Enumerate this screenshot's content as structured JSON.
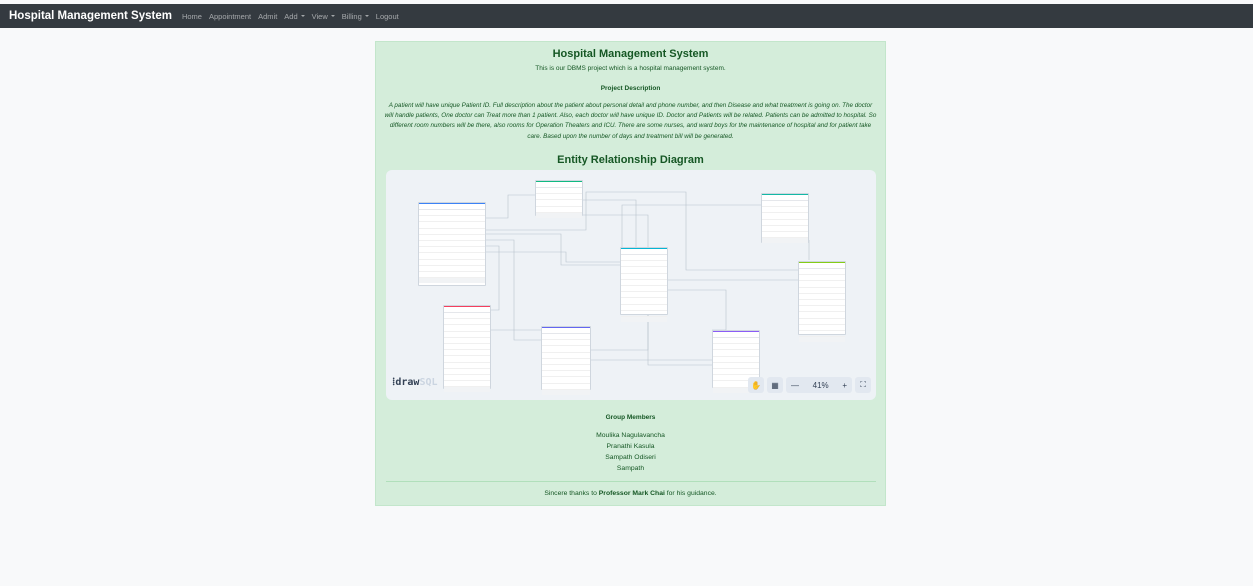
{
  "navbar": {
    "brand": "Hospital Management System",
    "items": [
      {
        "label": "Home",
        "dropdown": false
      },
      {
        "label": "Appointment",
        "dropdown": false
      },
      {
        "label": "Admit",
        "dropdown": false
      },
      {
        "label": "Add",
        "dropdown": true
      },
      {
        "label": "View",
        "dropdown": true
      },
      {
        "label": "Billing",
        "dropdown": true
      },
      {
        "label": "Logout",
        "dropdown": false
      }
    ]
  },
  "card": {
    "title": "Hospital Management System",
    "subtitle": "This is our DBMS project which is a hospital management system.",
    "description_heading": "Project Description",
    "description": "A patient will have unique Patient ID. Full description about the patient about personal detail and phone number, and then Disease and what treatment is going on. The doctor will handle patients, One doctor can Treat more than 1 patient. Also, each doctor will have unique ID. Doctor and Patients will be related. Patients can be admitted to hospital. So different room numbers will be there, also rooms for Operation Theaters and ICU. There are some nurses, and ward boys for the maintenance of hospital and for patient take care. Based upon the number of days and treatment bill will be generated.",
    "erd_heading": "Entity Relationship Diagram",
    "erd": {
      "logo_prefix": "draw",
      "logo_suffix": "SQL",
      "zoom": "41%",
      "controls": [
        "hand-icon",
        "grid-icon",
        "zoom-out-icon",
        "zoom-in-icon",
        "fullscreen-icon"
      ]
    },
    "members_heading": "Group Members",
    "members": [
      "Moulika Nagulavancha",
      "Pranathi Kasula",
      "Sampath Odiseri",
      "Sampath"
    ],
    "thanks_prefix": "Sincere thanks to",
    "thanks_name": "Professor Mark Chai",
    "thanks_suffix": "for his guidance."
  },
  "colors": {
    "navbar": "#343a40",
    "card_bg": "#d4edda",
    "card_text": "#155724"
  }
}
